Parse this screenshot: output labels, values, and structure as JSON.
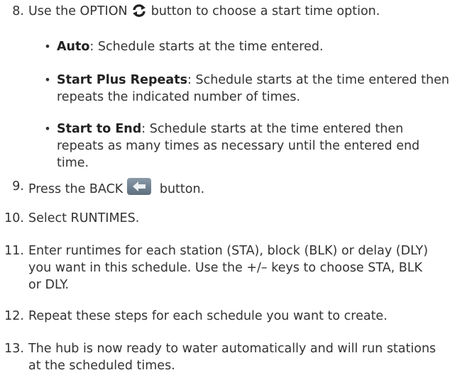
{
  "steps": [
    {
      "num": "8.",
      "before": "Use the OPTION",
      "after": " button to choose a start time option."
    },
    {
      "num": "9.",
      "before": "Press the BACK",
      "after": " button."
    },
    {
      "num": "10.",
      "text": "Select RUNTIMES."
    },
    {
      "num": "11.",
      "line1": "Enter runtimes for each station (STA), block (BLK) or delay (DLY)",
      "line2": "you want in this schedule. Use the +/– keys to choose STA, BLK",
      "line3": "or DLY."
    },
    {
      "num": "12.",
      "text": "Repeat these steps for each schedule you want to create."
    },
    {
      "num": "13.",
      "line1": "The hub is now ready to water automatically and will run stations",
      "line2": "at the scheduled times."
    }
  ],
  "options": [
    {
      "term": "Auto",
      "line1": ": Schedule starts at the time entered."
    },
    {
      "term": "Start Plus Repeats",
      "line1": ": Schedule starts at the time entered then",
      "line2": "repeats the indicated number of times."
    },
    {
      "term": "Start to End",
      "line1": ": Schedule starts at the time entered then",
      "line2": "repeats as many times as necessary until the entered end",
      "line3": "time."
    }
  ],
  "icons": {
    "option": "option-cycle-icon",
    "back": "back-arrow-icon"
  },
  "colors": {
    "text": "#333333",
    "back_button": "#6b7c8c"
  }
}
